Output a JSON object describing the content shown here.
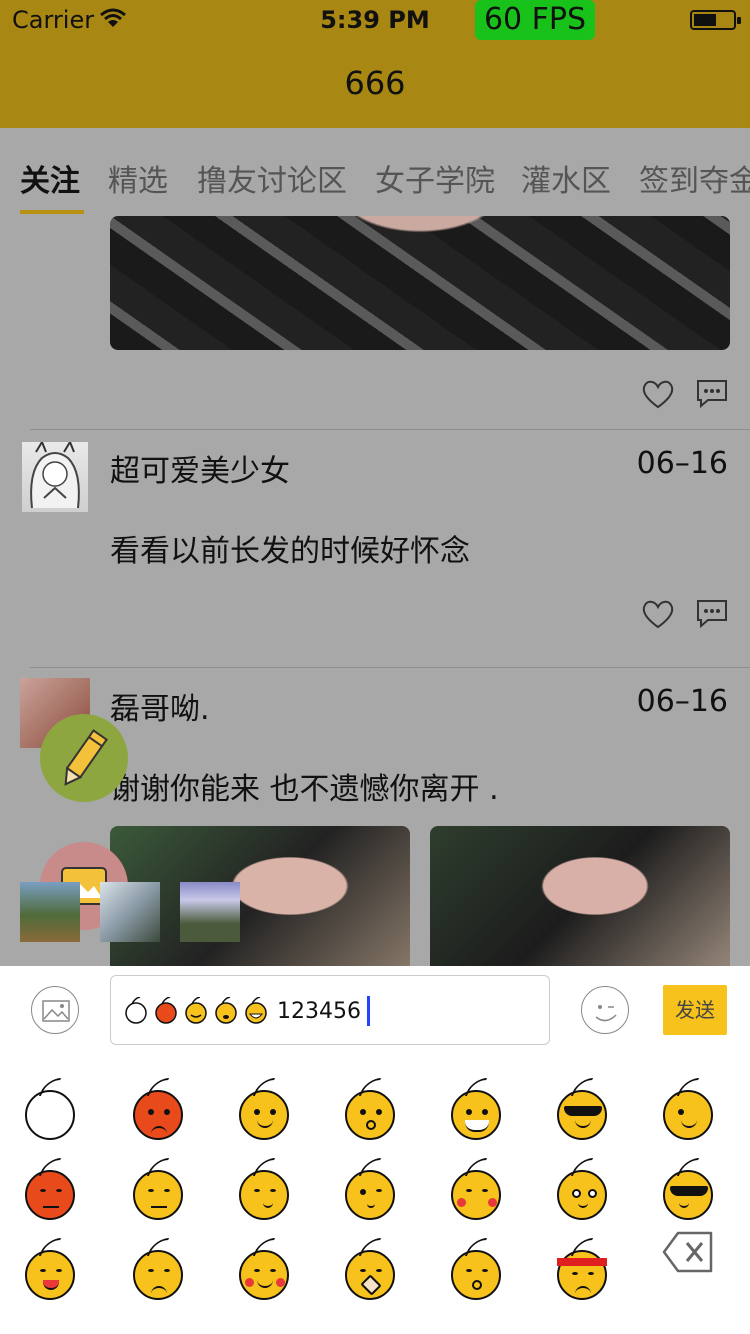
{
  "status_bar": {
    "carrier": "Carrier",
    "time": "5:39 PM",
    "fps": "60 FPS"
  },
  "nav": {
    "title": "666"
  },
  "tabs": [
    "关注",
    "精选",
    "撸友讨论区",
    "女子学院",
    "灌水区",
    "签到夺金"
  ],
  "posts": [
    {
      "name": "超可爱美少女",
      "date": "06–16",
      "text": "看看以前长发的时候好怀念"
    },
    {
      "name": "磊哥呦.",
      "date": "06–16",
      "text": "谢谢你能来 也不遗憾你离开 ."
    }
  ],
  "input": {
    "value": "123456",
    "send_label": "发送"
  },
  "colors": {
    "accent": "#f6c21b",
    "nav_bg": "#a88813",
    "fps_bg": "#19c21a",
    "overlay_bg": "#a8a8a8"
  },
  "icons": [
    "wifi-icon",
    "battery-icon",
    "heart-icon",
    "comment-icon",
    "pencil-icon",
    "image-icon",
    "photo-picker-icon",
    "emoji-toggle-icon",
    "backspace-icon"
  ],
  "emoji_names": [
    "blank",
    "angry",
    "smile",
    "scared",
    "laugh",
    "cool",
    "wink",
    "annoyed",
    "pout",
    "think",
    "shush",
    "shy",
    "frightened",
    "smoke",
    "happy",
    "sulk",
    "blush",
    "bandaged",
    "cry",
    "headband"
  ]
}
